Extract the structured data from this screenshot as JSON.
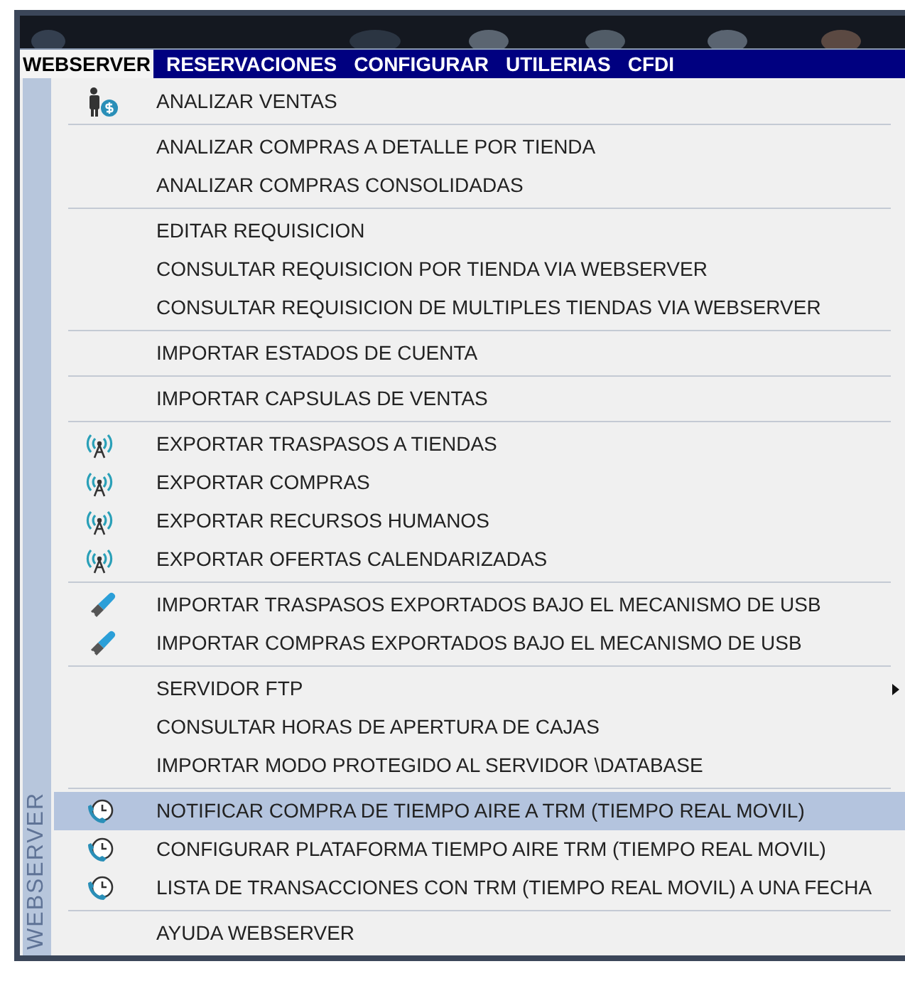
{
  "menu_bar": [
    {
      "label": "WEBSERVER",
      "selected": true
    },
    {
      "label": "RESERVACIONES",
      "selected": false
    },
    {
      "label": "CONFIGURAR",
      "selected": false
    },
    {
      "label": "UTILERIAS",
      "selected": false
    },
    {
      "label": "CFDI",
      "selected": false
    }
  ],
  "dropdown": {
    "side_label": "WEBSERVER",
    "groups": [
      [
        {
          "label": "ANALIZAR VENTAS",
          "kind": "money-person",
          "selected": false
        }
      ],
      [
        {
          "label": "ANALIZAR COMPRAS A DETALLE POR TIENDA",
          "selected": false
        },
        {
          "label": "ANALIZAR COMPRAS CONSOLIDADAS",
          "selected": false
        }
      ],
      [
        {
          "label": "EDITAR REQUISICION",
          "selected": false
        },
        {
          "label": "CONSULTAR REQUISICION POR TIENDA VIA WEBSERVER",
          "selected": false
        },
        {
          "label": "CONSULTAR REQUISICION DE MULTIPLES TIENDAS VIA WEBSERVER",
          "selected": false
        }
      ],
      [
        {
          "label": "IMPORTAR ESTADOS DE CUENTA",
          "selected": false
        }
      ],
      [
        {
          "label": "IMPORTAR CAPSULAS DE VENTAS",
          "selected": false
        }
      ],
      [
        {
          "label": "EXPORTAR TRASPASOS A TIENDAS",
          "kind": "antenna",
          "selected": false
        },
        {
          "label": "EXPORTAR COMPRAS",
          "kind": "antenna",
          "selected": false
        },
        {
          "label": "EXPORTAR RECURSOS HUMANOS",
          "kind": "antenna",
          "selected": false
        },
        {
          "label": "EXPORTAR OFERTAS CALENDARIZADAS",
          "kind": "antenna",
          "selected": false
        }
      ],
      [
        {
          "label": "IMPORTAR TRASPASOS EXPORTADOS BAJO EL MECANISMO DE USB",
          "kind": "usb",
          "selected": false
        },
        {
          "label": "IMPORTAR COMPRAS EXPORTADOS BAJO EL MECANISMO DE USB",
          "kind": "usb",
          "selected": false
        }
      ],
      [
        {
          "label": "SERVIDOR FTP",
          "submenu": true,
          "selected": false
        },
        {
          "label": "CONSULTAR HORAS DE APERTURA DE CAJAS",
          "selected": false
        },
        {
          "label": "IMPORTAR MODO PROTEGIDO AL SERVIDOR \\DATABASE",
          "selected": false
        }
      ],
      [
        {
          "label": "NOTIFICAR COMPRA DE TIEMPO AIRE A TRM (TIEMPO REAL MOVIL)",
          "kind": "phone-clock",
          "selected": true
        },
        {
          "label": "CONFIGURAR PLATAFORMA TIEMPO AIRE TRM (TIEMPO REAL MOVIL)",
          "kind": "phone-clock",
          "selected": false
        },
        {
          "label": "LISTA DE TRANSACCIONES CON TRM (TIEMPO REAL MOVIL) A UNA FECHA",
          "kind": "phone-clock",
          "selected": false
        }
      ],
      [
        {
          "label": "AYUDA WEBSERVER",
          "selected": false
        }
      ]
    ]
  }
}
